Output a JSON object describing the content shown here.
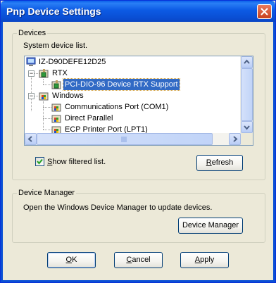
{
  "window": {
    "title": "Pnp Device Settings"
  },
  "devices": {
    "group_label": "Devices",
    "subtitle": "System device list.",
    "tree": [
      {
        "label": "IZ-D90DEFE12D25",
        "level": 0,
        "icon": "computer-icon",
        "expander": "",
        "selected": false
      },
      {
        "label": "RTX",
        "level": 1,
        "icon": "rtx-folder-icon",
        "expander": "−",
        "selected": false
      },
      {
        "label": "PCI-DIO-96 Device RTX Support",
        "level": 2,
        "icon": "rtx-device-icon",
        "expander": "",
        "selected": true
      },
      {
        "label": "Windows",
        "level": 1,
        "icon": "windows-folder-icon",
        "expander": "−",
        "selected": false
      },
      {
        "label": "Communications Port (COM1)",
        "level": 2,
        "icon": "windows-device-icon",
        "expander": "",
        "selected": false
      },
      {
        "label": "Direct Parallel",
        "level": 2,
        "icon": "windows-device-icon",
        "expander": "",
        "selected": false
      },
      {
        "label": "ECP Printer Port (LPT1)",
        "level": 2,
        "icon": "windows-device-icon",
        "expander": "",
        "selected": false
      }
    ],
    "show_filtered": {
      "label_mnemonic": "S",
      "label_rest": "how filtered list.",
      "checked": true
    },
    "refresh_button": {
      "mnemonic": "R",
      "rest": "efresh"
    }
  },
  "device_manager": {
    "group_label": "Device Manager",
    "description": "Open the Windows Device Manager to update devices.",
    "button": {
      "pre": "Device Mana",
      "mnemonic": "g",
      "post": "er"
    }
  },
  "footer": {
    "ok": {
      "mnemonic": "O",
      "rest": "K"
    },
    "cancel": {
      "mnemonic": "C",
      "rest": "ancel"
    },
    "apply": {
      "mnemonic": "A",
      "rest": "pply"
    }
  },
  "colors": {
    "title_bar": "#0a5fe8",
    "selection": "#316ac5",
    "dialog_bg": "#ece9d8"
  }
}
